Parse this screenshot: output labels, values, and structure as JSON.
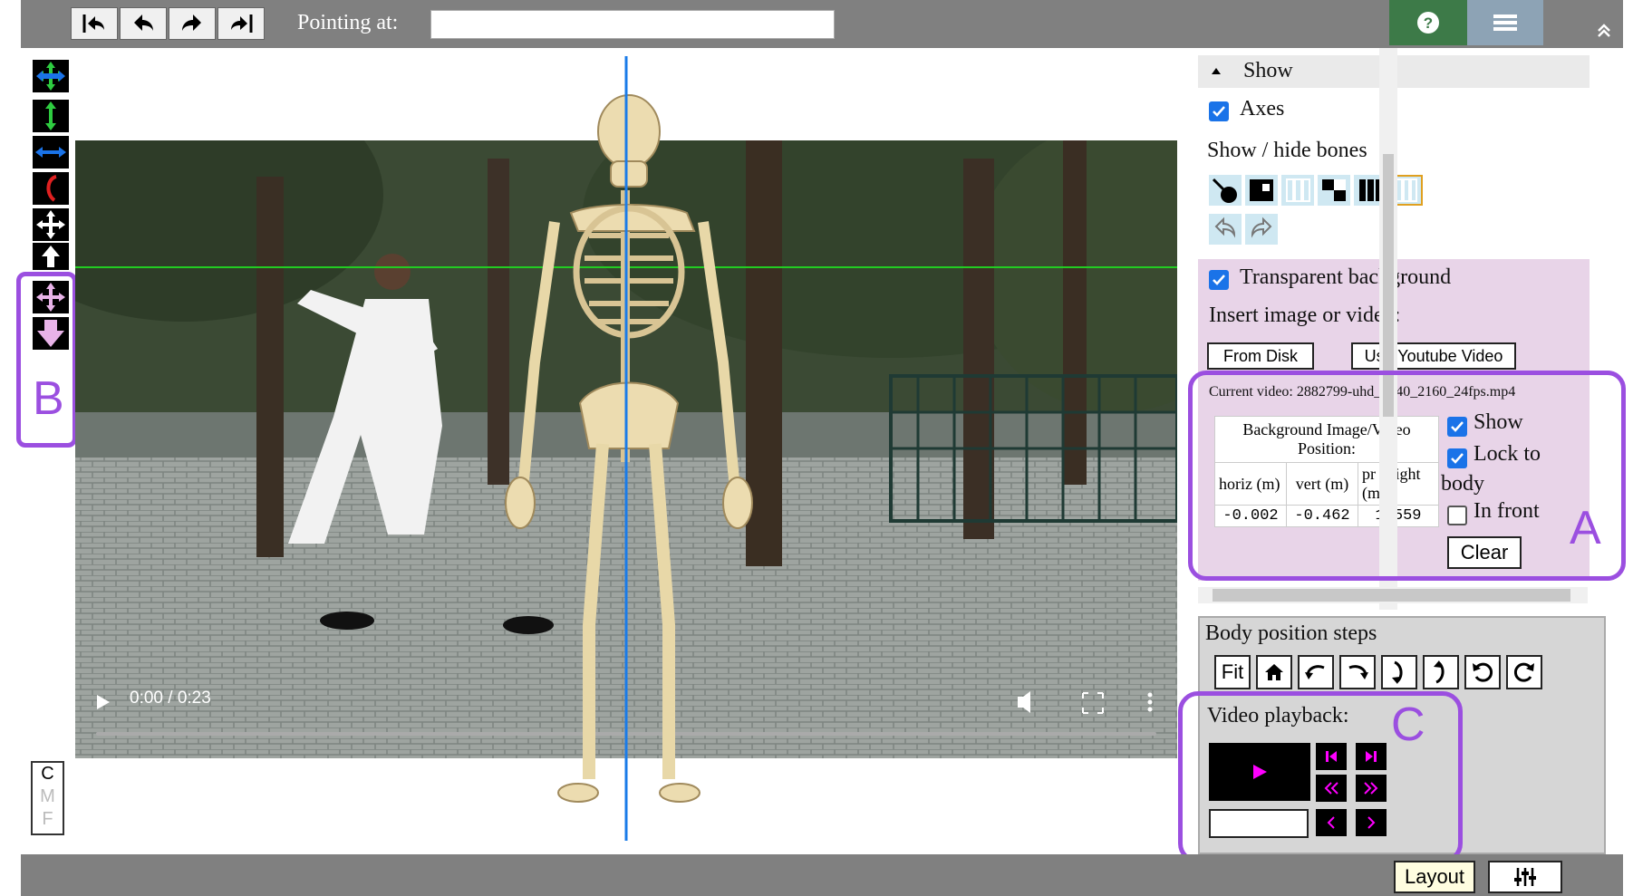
{
  "toolbar": {
    "pointing_label": "Pointing at:",
    "pointing_value": "",
    "icons": [
      "undo-all-icon",
      "undo-icon",
      "redo-icon",
      "redo-all-icon",
      "help-icon",
      "menu-icon",
      "collapse-up-icon"
    ]
  },
  "left_tools": {
    "box_label": "B",
    "cmf": [
      "C",
      "M",
      "F"
    ]
  },
  "video": {
    "time": "0:00 / 0:23"
  },
  "show_panel": {
    "header": "Show",
    "axes_label": "Axes",
    "axes_checked": true,
    "bones_label": "Show / hide bones",
    "transparent_label": "Transparent background",
    "transparent_checked": true,
    "insert_label": "Insert image or video:",
    "from_disk": "From Disk",
    "youtube": "Use Youtube Video",
    "current_video": "Current video: 2882799-uhd_3840_2160_24fps.mp4",
    "position_header": "Background Image/Video Position:",
    "col_horiz": "horiz (m)",
    "col_vert": "vert (m)",
    "col_height": "pr height (m)",
    "horiz": "-0.002",
    "vert": "-0.462",
    "height": "1.559",
    "show_label": "Show",
    "show_checked": true,
    "lock_label_1": "Lock to",
    "lock_label_2": "body",
    "lock_checked": true,
    "infront_label": "In front",
    "infront_checked": false,
    "clear_label": "Clear",
    "box_label": "A"
  },
  "body_steps": {
    "title": "Body position steps",
    "fit_label": "Fit"
  },
  "playback": {
    "title": "Video playback:",
    "frame_value": "",
    "box_label": "C"
  },
  "bottom": {
    "layout_label": "Layout"
  },
  "colors": {
    "accent_purple": "#9b4fe0",
    "magenta": "#ff00ff",
    "help_green": "#3d7a48",
    "menu_blue": "#8da3b5",
    "checkbox_blue": "#1a73e8"
  }
}
